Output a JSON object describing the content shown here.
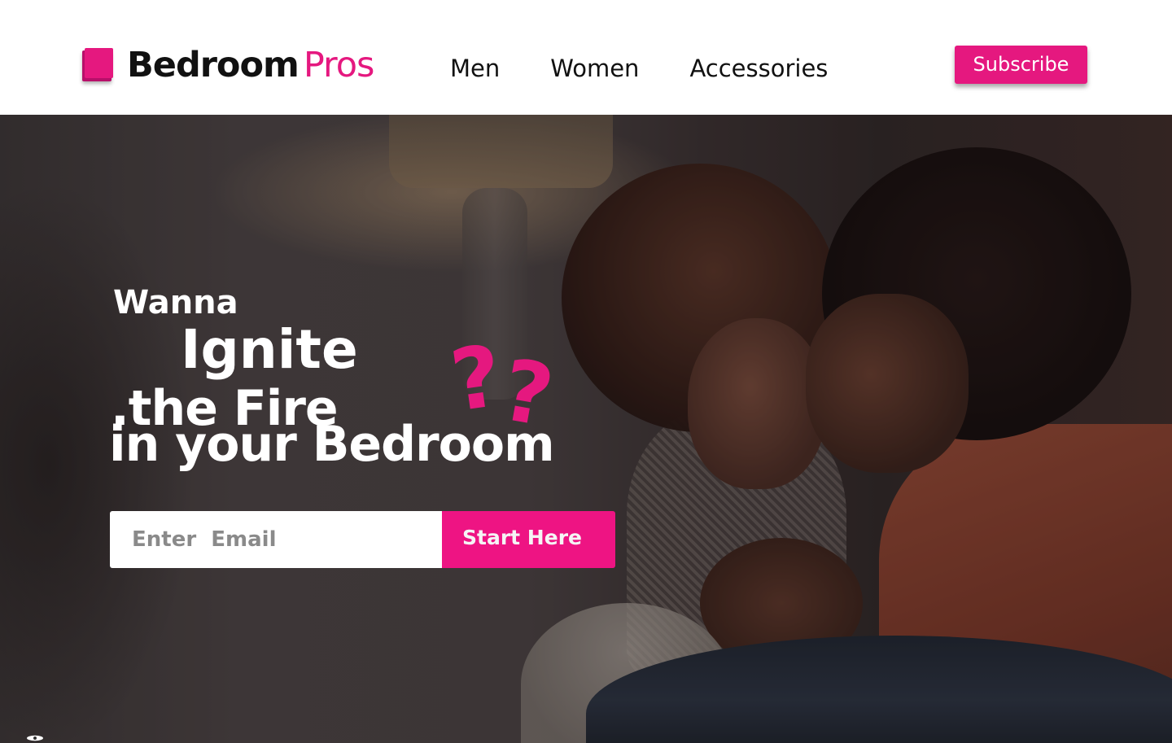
{
  "header": {
    "logo": {
      "icon": "logo-squares-icon",
      "brand_primary": "Bedroom",
      "brand_secondary": "Pros"
    },
    "nav": [
      {
        "label": "Men"
      },
      {
        "label": "Women"
      },
      {
        "label": "Accessories"
      }
    ],
    "subscribe_label": "Subscribe"
  },
  "hero": {
    "headline": {
      "line1": "Wanna",
      "line2": "Ignite",
      "line3": ".the Fire",
      "line4": "in your Bedroom",
      "decoration": "??"
    },
    "signup": {
      "email_placeholder": "Enter  Email",
      "email_value": "",
      "submit_label": "Start Here"
    },
    "corner_icon": "eye-icon"
  },
  "colors": {
    "accent": "#e5187f",
    "button_accent": "#ee1483",
    "text_dark": "#111111",
    "text_light": "#ffffff"
  }
}
